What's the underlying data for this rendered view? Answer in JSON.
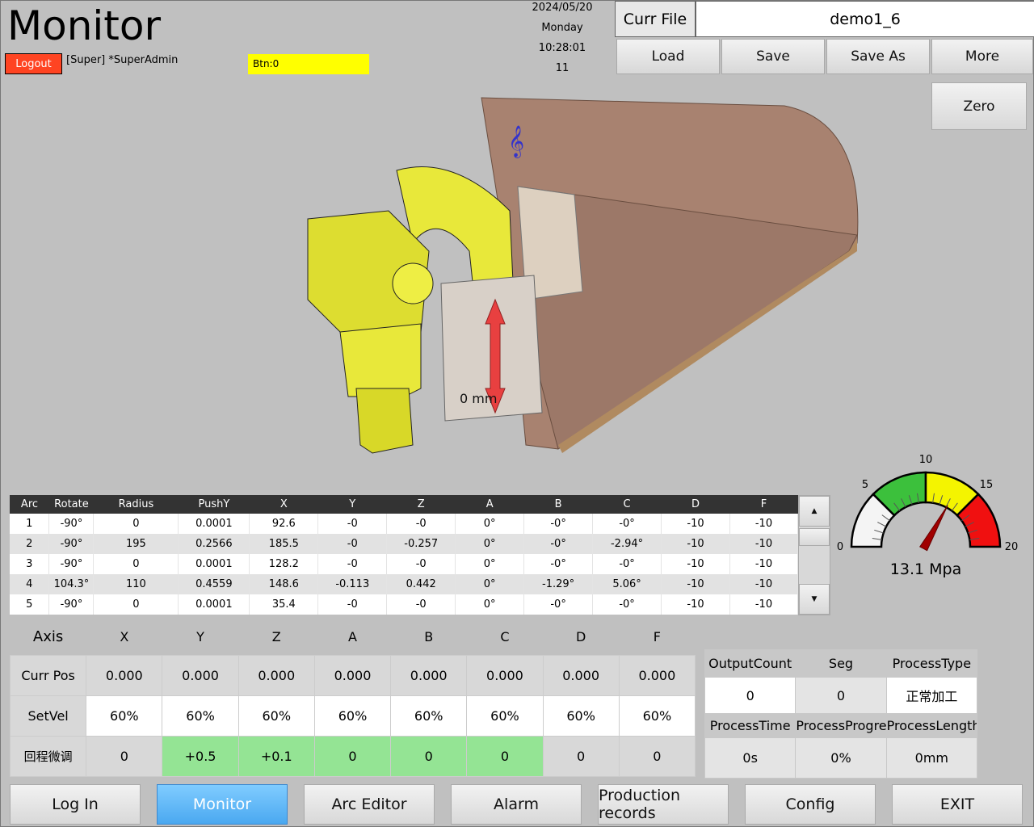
{
  "header": {
    "title": "Monitor",
    "logout": "Logout",
    "user": "[Super] *SuperAdmin",
    "btn_status": "Btn:0",
    "date": "2024/05/20",
    "weekday": "Monday",
    "time": "10:28:01",
    "counter": "11"
  },
  "file": {
    "label": "Curr File",
    "name": "demo1_6",
    "buttons": [
      "Load",
      "Save",
      "Save As",
      "More"
    ],
    "zero": "Zero"
  },
  "scene": {
    "push_label": "0 mm"
  },
  "arc_table": {
    "columns": [
      "Arc",
      "Rotate",
      "Radius",
      "PushY",
      "X",
      "Y",
      "Z",
      "A",
      "B",
      "C",
      "D",
      "F"
    ],
    "rows": [
      [
        "1",
        "-90°",
        "0",
        "0.0001",
        "92.6",
        "-0",
        "-0",
        "0°",
        "-0°",
        "-0°",
        "-10",
        "-10"
      ],
      [
        "2",
        "-90°",
        "195",
        "0.2566",
        "185.5",
        "-0",
        "-0.257",
        "0°",
        "-0°",
        "-2.94°",
        "-10",
        "-10"
      ],
      [
        "3",
        "-90°",
        "0",
        "0.0001",
        "128.2",
        "-0",
        "-0",
        "0°",
        "-0°",
        "-0°",
        "-10",
        "-10"
      ],
      [
        "4",
        "104.3°",
        "110",
        "0.4559",
        "148.6",
        "-0.113",
        "0.442",
        "0°",
        "-1.29°",
        "5.06°",
        "-10",
        "-10"
      ],
      [
        "5",
        "-90°",
        "0",
        "0.0001",
        "35.4",
        "-0",
        "-0",
        "0°",
        "-0°",
        "-0°",
        "-10",
        "-10"
      ]
    ]
  },
  "gauge": {
    "min": 0,
    "max": 20,
    "value": 13.1,
    "ticks": [
      "0",
      "5",
      "10",
      "15",
      "20"
    ],
    "readout": "13.1 Mpa",
    "zones": [
      {
        "to": 5,
        "color": "#f4f4f4"
      },
      {
        "to": 10,
        "color": "#3cc03c"
      },
      {
        "to": 15,
        "color": "#f4f400"
      },
      {
        "to": 20,
        "color": "#f01010"
      }
    ]
  },
  "axis_table": {
    "header": [
      "Axis",
      "X",
      "Y",
      "Z",
      "A",
      "B",
      "C",
      "D",
      "F"
    ],
    "rows": [
      {
        "label": "Curr Pos",
        "values": [
          "0.000",
          "0.000",
          "0.000",
          "0.000",
          "0.000",
          "0.000",
          "0.000",
          "0.000"
        ]
      },
      {
        "label": "SetVel",
        "values": [
          "60%",
          "60%",
          "60%",
          "60%",
          "60%",
          "60%",
          "60%",
          "60%"
        ]
      },
      {
        "label": "回程微调",
        "values": [
          "0",
          "+0.5",
          "+0.1",
          "0",
          "0",
          "0",
          "0",
          "0"
        ],
        "highlight": [
          false,
          true,
          true,
          true,
          true,
          true,
          false,
          false
        ]
      }
    ]
  },
  "info": {
    "headers1": [
      "OutputCount",
      "Seg",
      "ProcessType"
    ],
    "values1": [
      "0",
      "0",
      "正常加工"
    ],
    "headers2": [
      "ProcessTime",
      "ProcessProgres",
      "ProcessLength"
    ],
    "values2": [
      "0s",
      "0%",
      "0mm"
    ]
  },
  "nav": {
    "items": [
      "Log In",
      "Monitor",
      "Arc Editor",
      "Alarm",
      "Production records",
      "Config",
      "EXIT"
    ],
    "active": 1
  }
}
